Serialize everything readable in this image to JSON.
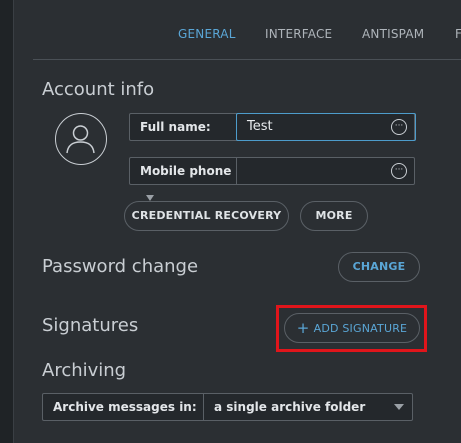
{
  "tabs": [
    {
      "label": "GENERAL",
      "active": true
    },
    {
      "label": "INTERFACE",
      "active": false
    },
    {
      "label": "ANTISPAM",
      "active": false
    },
    {
      "label": "F",
      "active": false
    }
  ],
  "account_info": {
    "title": "Account info",
    "full_name_label": "Full name:",
    "full_name_value": "Test",
    "mobile_phone_label": "Mobile phone",
    "mobile_phone_value": "",
    "more_icon": "ellipsis-icon",
    "credential_recovery_label": "CREDENTIAL RECOVERY",
    "more_label": "MORE"
  },
  "password_change": {
    "title": "Password change",
    "change_label": "CHANGE"
  },
  "signatures": {
    "title": "Signatures",
    "add_icon": "plus-icon",
    "add_label": "ADD SIGNATURE"
  },
  "archiving": {
    "title": "Archiving",
    "archive_label": "Archive messages in:",
    "archive_value": "a single archive folder"
  },
  "colors": {
    "background": "#2b2f33",
    "accent": "#5aa6d6",
    "highlight": "#e0151b"
  }
}
